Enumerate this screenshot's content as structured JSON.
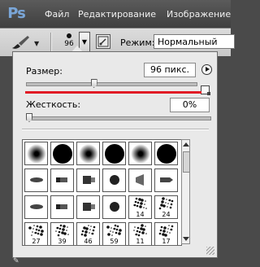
{
  "app": {
    "logo": "Ps"
  },
  "menu": {
    "items": [
      "Файл",
      "Редактирование",
      "Изображение"
    ]
  },
  "options_bar": {
    "brush_size_value": "96",
    "mode_label": "Режим:",
    "mode_value": "Нормальный"
  },
  "brush_panel": {
    "size_label": "Размер:",
    "size_value": "96 пикс.",
    "size_fraction": 0.4,
    "hardness_label": "Жесткость:",
    "hardness_value": "0%",
    "hardness_fraction": 0.0,
    "highlight_color": "#e11b25",
    "presets": [
      {
        "kind": "soft",
        "label": ""
      },
      {
        "kind": "hard",
        "label": ""
      },
      {
        "kind": "soft",
        "label": ""
      },
      {
        "kind": "hard",
        "label": ""
      },
      {
        "kind": "soft",
        "label": ""
      },
      {
        "kind": "hard",
        "label": ""
      },
      {
        "kind": "brush-tip",
        "label": ""
      },
      {
        "kind": "brush-tip",
        "label": ""
      },
      {
        "kind": "brush-tip",
        "label": ""
      },
      {
        "kind": "brush-tip",
        "label": ""
      },
      {
        "kind": "brush-tip",
        "label": ""
      },
      {
        "kind": "brush-tip",
        "label": ""
      },
      {
        "kind": "brush-tip",
        "label": ""
      },
      {
        "kind": "brush-tip",
        "label": ""
      },
      {
        "kind": "brush-tip",
        "label": ""
      },
      {
        "kind": "brush-tip",
        "label": ""
      },
      {
        "kind": "scatter",
        "label": "14"
      },
      {
        "kind": "scatter",
        "label": "24"
      },
      {
        "kind": "scatter",
        "label": "27"
      },
      {
        "kind": "scatter",
        "label": "39"
      },
      {
        "kind": "scatter",
        "label": "46"
      },
      {
        "kind": "scatter",
        "label": "59"
      },
      {
        "kind": "scatter",
        "label": "11"
      },
      {
        "kind": "scatter",
        "label": "17"
      }
    ]
  },
  "icons": {
    "tool": "brush-icon",
    "toggle": "brush-panel-toggle-icon",
    "panel_menu": "panel-menu-arrow-icon",
    "new_preset": "new-preset-icon"
  }
}
